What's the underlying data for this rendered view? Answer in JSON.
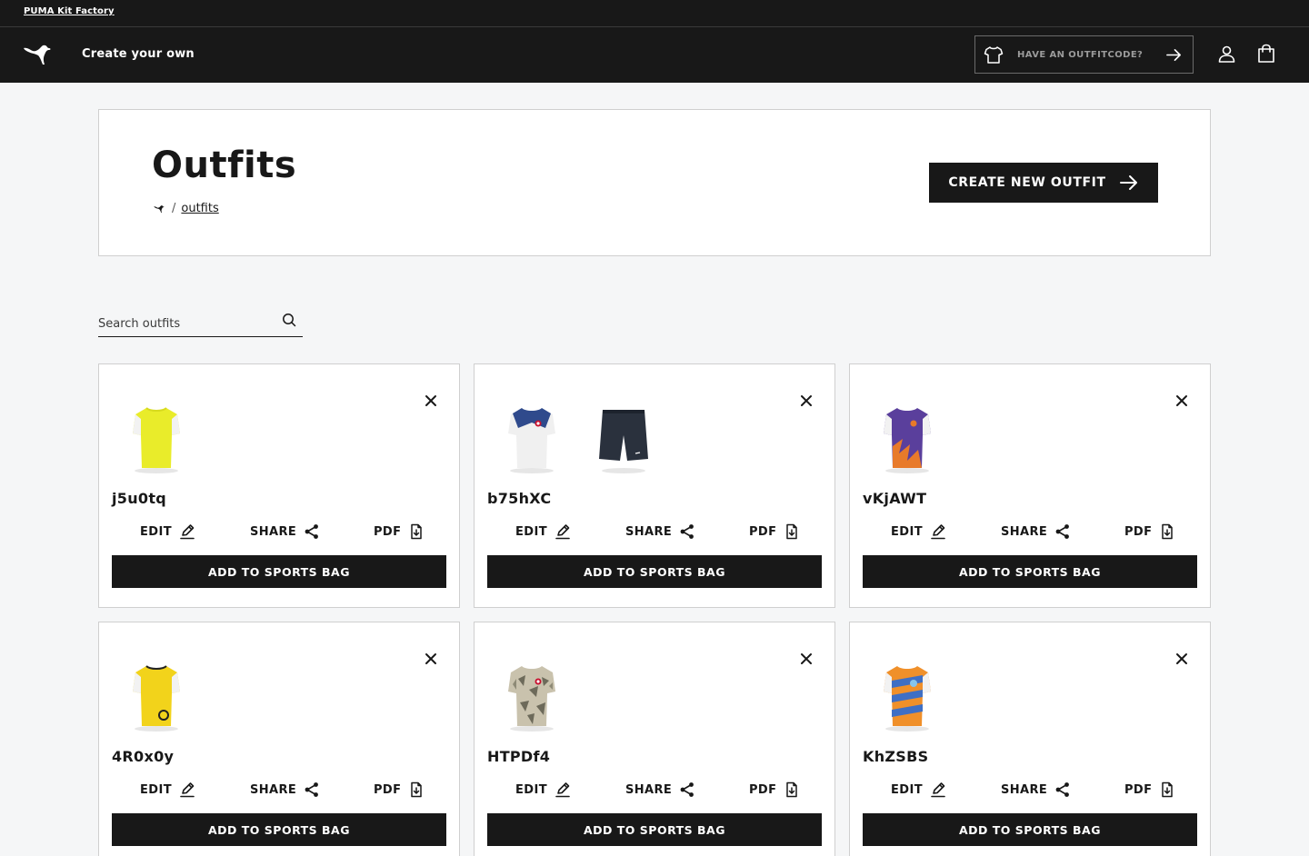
{
  "topbar": {
    "brand_link": "PUMA Kit Factory"
  },
  "navbar": {
    "title": "Create your own",
    "outfitcode_placeholder": "HAVE AN OUTFITCODE?"
  },
  "header": {
    "title": "Outfits",
    "breadcrumb_sep": "/",
    "breadcrumb_current": "outfits",
    "create_button": "CREATE NEW OUTFIT"
  },
  "search": {
    "placeholder": "Search outfits"
  },
  "labels": {
    "edit": "EDIT",
    "share": "SHARE",
    "pdf": "PDF",
    "add_to_bag": "ADD TO SPORTS BAG"
  },
  "outfits": [
    {
      "name": "j5u0tq",
      "items": [
        "yellow-white-shirt"
      ]
    },
    {
      "name": "b75hXC",
      "items": [
        "white-blue-club-shirt",
        "navy-shorts"
      ]
    },
    {
      "name": "vKjAWT",
      "items": [
        "purple-orange-shirt"
      ]
    },
    {
      "name": "4R0x0y",
      "items": [
        "yellow-club-shirt"
      ]
    },
    {
      "name": "HTPDf4",
      "items": [
        "camo-club-shirt"
      ]
    },
    {
      "name": "KhZSBS",
      "items": [
        "orange-blue-stripe-shirt"
      ]
    }
  ],
  "colors": {
    "dark": "#181818",
    "page_bg": "#f5f6f7",
    "card_border": "#cfcfcf"
  }
}
